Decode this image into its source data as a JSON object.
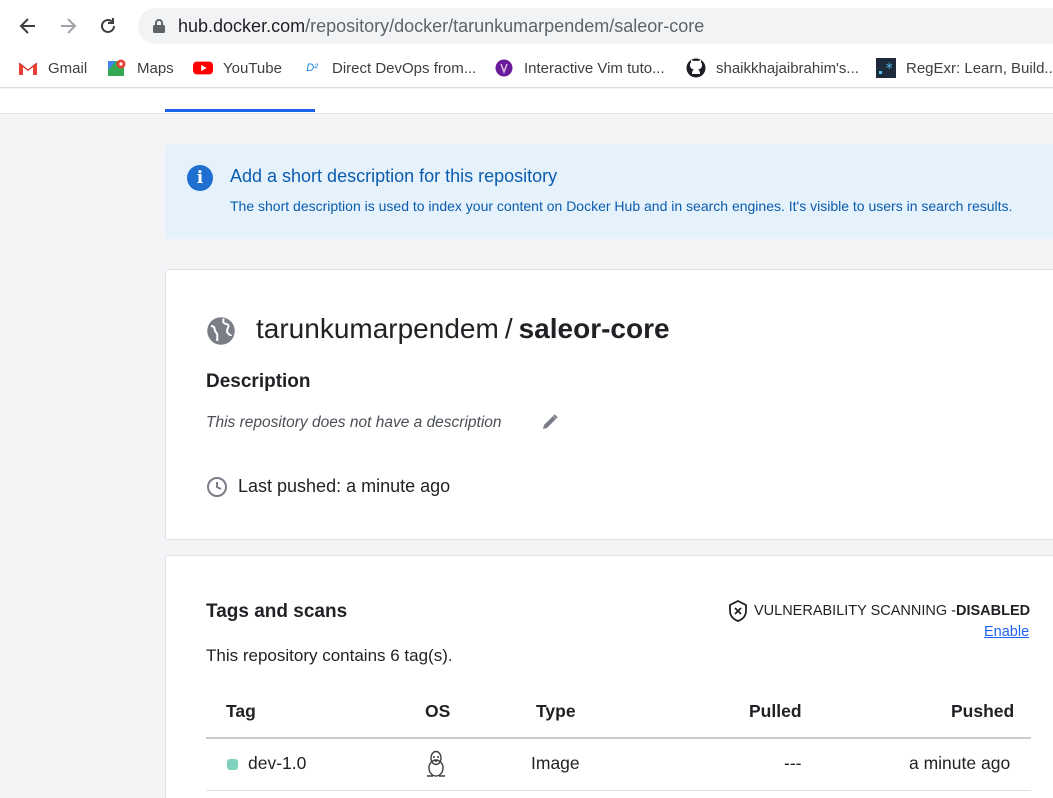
{
  "browser": {
    "url_host": "hub.docker.com",
    "url_path": "/repository/docker/tarunkumarpendem/saleor-core",
    "bookmarks": [
      {
        "label": "Gmail",
        "icon": "gmail-icon"
      },
      {
        "label": "Maps",
        "icon": "maps-icon"
      },
      {
        "label": "YouTube",
        "icon": "youtube-icon"
      },
      {
        "label": "Direct DevOps from...",
        "icon": "devops-icon"
      },
      {
        "label": "Interactive Vim tuto...",
        "icon": "vim-icon"
      },
      {
        "label": "shaikkhajaibrahim's...",
        "icon": "github-icon"
      },
      {
        "label": "RegExr: Learn, Build...",
        "icon": "regexr-icon"
      }
    ]
  },
  "banner": {
    "title": "Add a short description for this repository",
    "text": "The short description is used to index your content on Docker Hub and in search engines. It's visible to users in search results."
  },
  "repo": {
    "namespace": "tarunkumarpendem",
    "separator": "/",
    "name": "saleor-core",
    "description_heading": "Description",
    "description_text": "This repository does not have a description",
    "last_pushed": "Last pushed: a minute ago"
  },
  "tags": {
    "heading": "Tags and scans",
    "vuln_label": "VULNERABILITY SCANNING - ",
    "vuln_status": "DISABLED",
    "enable_link": "Enable",
    "count_text": "This repository contains 6 tag(s).",
    "columns": {
      "tag": "Tag",
      "os": "OS",
      "type": "Type",
      "pulled": "Pulled",
      "pushed": "Pushed"
    },
    "rows": [
      {
        "tag": "dev-1.0",
        "os": "linux-icon",
        "type": "Image",
        "pulled": "---",
        "pushed": "a minute ago",
        "status_color": "#7fd1bd"
      }
    ]
  },
  "colors": {
    "accent": "#1d63ed",
    "banner_bg": "#e5f2fc",
    "banner_text": "#0b5cad"
  }
}
